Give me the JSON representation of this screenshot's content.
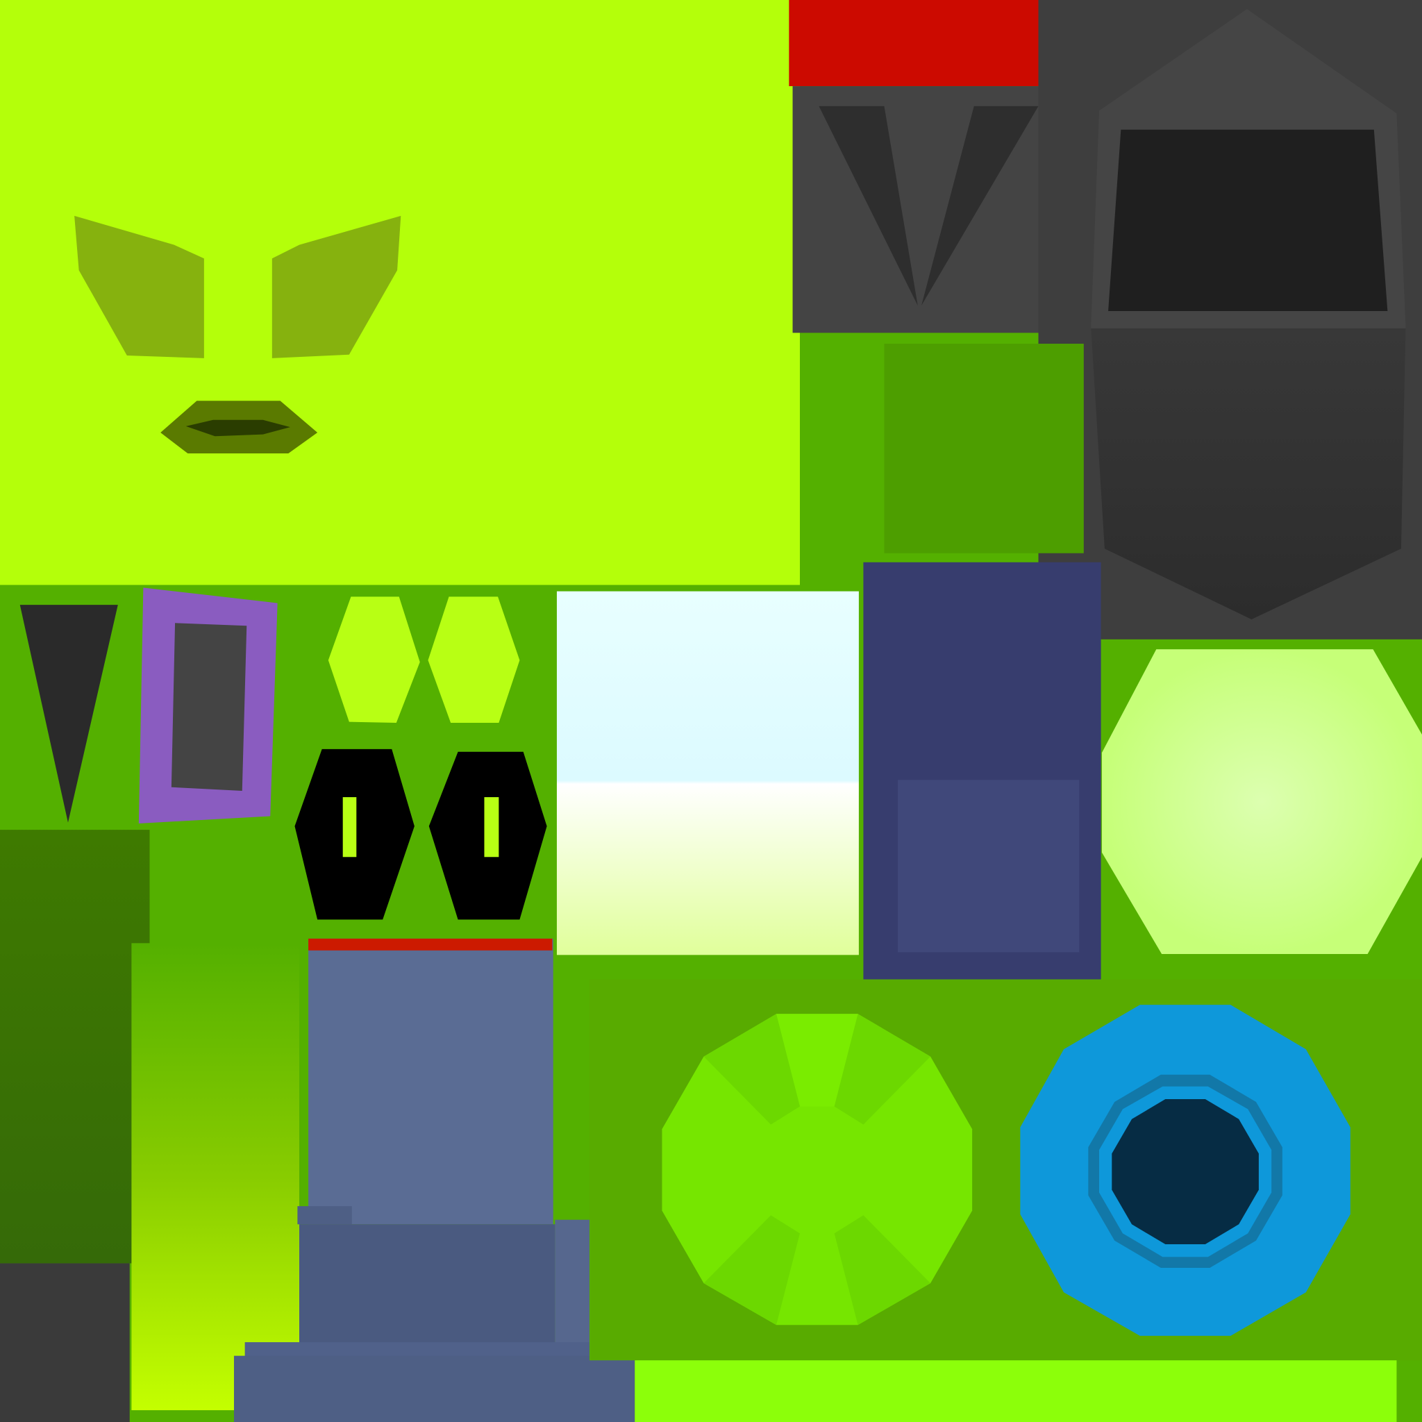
{
  "texture_atlas": {
    "colors": {
      "background": "#54b000",
      "face_skin": "#b4ff0a",
      "eye_shape": "#86b20e",
      "mouth_outer": "#5a7a00",
      "mouth_inner": "#2a3d00",
      "red_strip": "#cc0a00",
      "suit_gray": "#444444",
      "tie_dark": "#2e2e2e",
      "helmet_back": "#3e3e3e",
      "visor_dark": "#1f1f1f",
      "green_patch": "#4d9e00",
      "purple_frame": "#8a5cc0",
      "hex_yellow": "#b8ff14",
      "eye_black": "#000000",
      "navy_panel": "#373d6e",
      "light_green_octagon": "#c6ff78",
      "dark_green_column": "#3b7700",
      "robot_bluegray": "#5a6c94",
      "green_gem": "#76e600",
      "blue_gem": "#0e98da",
      "blue_gem_core": "#062c44",
      "bright_strip": "#8cff0a"
    }
  }
}
